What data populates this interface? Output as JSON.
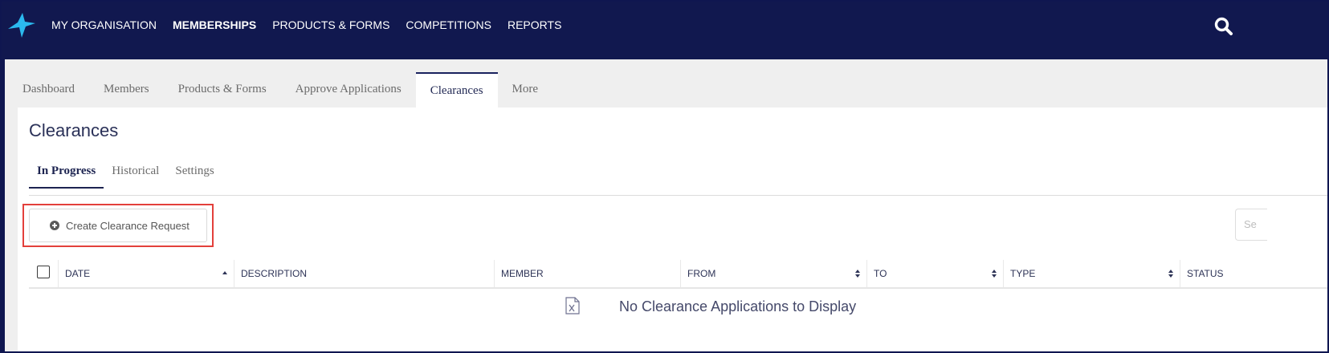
{
  "topnav": {
    "items": [
      {
        "label": "MY ORGANISATION",
        "active": false
      },
      {
        "label": "MEMBERSHIPS",
        "active": true
      },
      {
        "label": "PRODUCTS & FORMS",
        "active": false
      },
      {
        "label": "COMPETITIONS",
        "active": false
      },
      {
        "label": "REPORTS",
        "active": false
      }
    ],
    "search_icon": "search-icon"
  },
  "tabs": [
    {
      "label": "Dashboard",
      "active": false
    },
    {
      "label": "Members",
      "active": false
    },
    {
      "label": "Products & Forms",
      "active": false
    },
    {
      "label": "Approve Applications",
      "active": false
    },
    {
      "label": "Clearances",
      "active": true
    },
    {
      "label": "More",
      "active": false
    }
  ],
  "page": {
    "title": "Clearances",
    "subtabs": [
      {
        "label": "In Progress",
        "active": true
      },
      {
        "label": "Historical",
        "active": false
      },
      {
        "label": "Settings",
        "active": false
      }
    ],
    "create_button_label": "Create Clearance Request",
    "search_placeholder": "Se"
  },
  "table": {
    "columns": [
      "DATE",
      "DESCRIPTION",
      "MEMBER",
      "FROM",
      "TO",
      "TYPE",
      "STATUS"
    ],
    "empty_message": "No Clearance Applications to Display"
  },
  "colors": {
    "topbar": "#11184f",
    "accent": "#1a225e",
    "highlight": "#e3403b",
    "logo": "#2bb9ee"
  }
}
